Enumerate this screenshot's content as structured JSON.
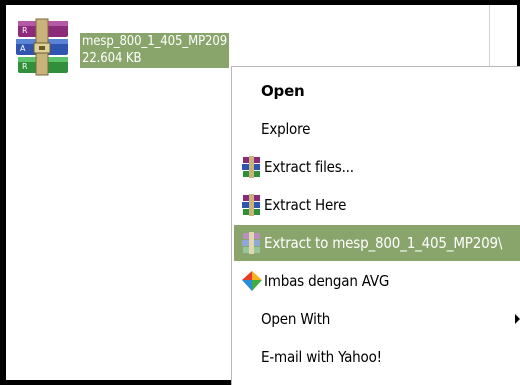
{
  "file": {
    "name": "mesp_800_1_405_MP209",
    "size": "22.604 KB",
    "icon": "winrar-archive-icon"
  },
  "colors": {
    "selection": "#8aa56c",
    "menu_bg": "#ffffff",
    "text": "#000000"
  },
  "context_menu": {
    "items": [
      {
        "label": "Open",
        "icon": "",
        "default": true
      },
      {
        "label": "Explore",
        "icon": ""
      },
      {
        "label": "Extract files...",
        "icon": "winrar-icon"
      },
      {
        "label": "Extract Here",
        "icon": "winrar-icon"
      },
      {
        "label": "Extract to mesp_800_1_405_MP209\\",
        "icon": "winrar-icon",
        "highlighted": true
      },
      {
        "label": "Imbas dengan AVG",
        "icon": "avg-icon"
      },
      {
        "label": "Open With",
        "icon": "",
        "has_submenu": true
      },
      {
        "label": "E-mail with Yahoo!",
        "icon": ""
      }
    ]
  }
}
